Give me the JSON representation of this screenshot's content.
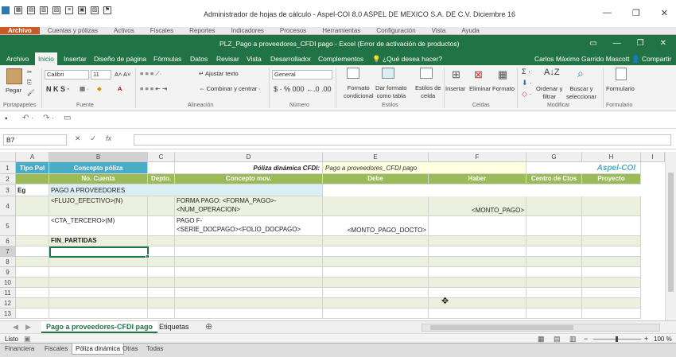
{
  "outer": {
    "title": "Administrador de hojas de cálculo - Aspel-COI 8.0 ASPEL DE MEXICO S.A. DE C.V. Diciembre 16",
    "menu": [
      "Archivo",
      "Cuentas y pólizas",
      "Activos",
      "Fiscales",
      "Reportes",
      "Indicadores",
      "Procesos",
      "Herramientas",
      "Configuración",
      "Vista",
      "Ayuda"
    ],
    "bottom_tabs": [
      "Financiera",
      "Fiscales",
      "Póliza dinámica",
      "Otras",
      "Todas"
    ]
  },
  "excel": {
    "title": "PLZ_Pago a proveedores_CFDI pago - Excel (Error de activación de productos)",
    "tabs": [
      "Archivo",
      "Inicio",
      "Insertar",
      "Diseño de página",
      "Fórmulas",
      "Datos",
      "Revisar",
      "Vista",
      "Desarrollador",
      "Complementos"
    ],
    "tell_me": "¿Qué desea hacer?",
    "user": "Carlos Máximo Garrido Mascott",
    "share": "Compartir"
  },
  "ribbon": {
    "paste": "Pegar",
    "font_name": "Calibri",
    "font_size": "11",
    "wrap_text": "Ajustar texto",
    "merge_center": "Combinar y centrar",
    "number_format": "General",
    "cond_format": [
      "Formato",
      "condicional"
    ],
    "format_table": [
      "Dar formato",
      "como tabla"
    ],
    "cell_styles": [
      "Estilos de",
      "celda"
    ],
    "insert": "Insertar",
    "delete": "Eliminar",
    "format": "Formato",
    "sort_filter": [
      "Ordenar y",
      "filtrar"
    ],
    "find_select": [
      "Buscar y",
      "seleccionar"
    ],
    "forms": "Formulario",
    "groups": [
      "Portapapeles",
      "Fuente",
      "Alineación",
      "Número",
      "Estilos",
      "Celdas",
      "Modificar",
      "Formulario"
    ]
  },
  "formula_bar": {
    "name_box": "B7",
    "fx": "fx",
    "value": ""
  },
  "columns": [
    "A",
    "B",
    "C",
    "D",
    "E",
    "F",
    "G",
    "H",
    "I"
  ],
  "rows": [
    "1",
    "2",
    "3",
    "4",
    "5",
    "6",
    "7",
    "8",
    "9",
    "10",
    "11",
    "12",
    "13"
  ],
  "cells": {
    "A1": "Tipo Pol",
    "B1": "Concepto póliza",
    "D1": "Póliza dinámica CFDI:",
    "E1": "Pago a proveedores_CFDI pago",
    "H1": "Aspel-COI",
    "B2": "No. Cuenta",
    "C2": "Depto.",
    "D2": "Concepto mov.",
    "E2": "Debe",
    "F2": "Haber",
    "G2": "Centro de Ctos",
    "H2": "Proyecto",
    "A3": "Eg",
    "B3": "PAGO A PROVEEDORES",
    "B4": "<FLUJO_EFECTIVO>(N)",
    "D4a": "FORMA PAGO: <FORMA_PAGO>-",
    "D4b": "<NUM_OPERACION>",
    "F4": "<MONTO_PAGO>",
    "B5": "<CTA_TERCERO>(M)",
    "D5a": "PAGO F-",
    "D5b": "<SERIE_DOCPAGO><FOLIO_DOCPAGO>",
    "E5": "<MONTO_PAGO_DOCTO>",
    "B6": "FIN_PARTIDAS"
  },
  "sheet_tabs": [
    "Pago a proveedores-CFDI pago",
    "Etiquetas"
  ],
  "status": {
    "ready": "Listo",
    "zoom": "100 %"
  },
  "colors": {
    "excel_green": "#217346",
    "header_blue": "#4bacc6",
    "header_green": "#9bbb59",
    "row_green": "#ebf1de",
    "accent_orange": "#c95a25"
  }
}
